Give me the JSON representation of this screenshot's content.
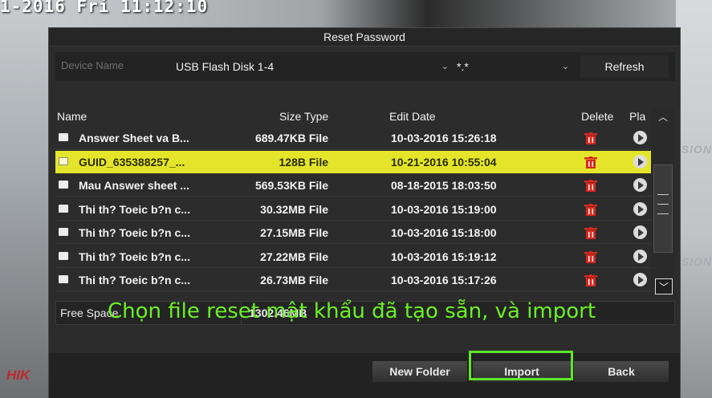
{
  "osd": {
    "timestamp": "1-2016 Fri 11:12:10",
    "logo": "HIK",
    "side_text_1": "SION",
    "side_text_2": "SION"
  },
  "dialog": {
    "title": "Reset Password",
    "device_label": "Device Name",
    "device_value": "USB Flash Disk 1-4",
    "filter_value": "*.*",
    "refresh_label": "Refresh"
  },
  "table": {
    "headers": {
      "name": "Name",
      "size_type": "Size Type",
      "edit_date": "Edit Date",
      "delete": "Delete",
      "play": "Pla"
    },
    "rows": [
      {
        "name": "Answer Sheet va B...",
        "size": "689.47KB File",
        "date": "10-03-2016 15:26:18"
      },
      {
        "name": "GUID_635388257_...",
        "size": "128B File",
        "date": "10-21-2016 10:55:04"
      },
      {
        "name": "Mau Answer sheet ...",
        "size": "569.53KB File",
        "date": "08-18-2015 18:03:50"
      },
      {
        "name": "Thi th? Toeic b?n c...",
        "size": "30.32MB File",
        "date": "10-03-2016 15:19:00"
      },
      {
        "name": "Thi th? Toeic b?n c...",
        "size": "27.15MB File",
        "date": "10-03-2016 15:18:00"
      },
      {
        "name": "Thi th? Toeic b?n c...",
        "size": "27.22MB File",
        "date": "10-03-2016 15:19:12"
      },
      {
        "name": "Thi th? Toeic b?n c...",
        "size": "26.73MB File",
        "date": "10-03-2016 15:17:26"
      }
    ],
    "selected_index": 1
  },
  "free_space": {
    "label": "Free Space",
    "value": "1302.46MB"
  },
  "caption": "Chọn file reset mật khẩu đã tạo sẵn, và import",
  "buttons": {
    "new_folder": "New Folder",
    "import": "Import",
    "back": "Back"
  },
  "colors": {
    "selected_row": "#e4e52a",
    "caption_green": "#6bf028",
    "delete_red": "#d8281e",
    "highlight_box": "#5ee62a"
  },
  "icons": {
    "file": "file-icon",
    "delete": "trash-icon",
    "play": "play-icon",
    "scroll_up": "chevron-up-icon",
    "scroll_down": "chevron-down-icon",
    "dropdown": "chevron-down-icon"
  }
}
